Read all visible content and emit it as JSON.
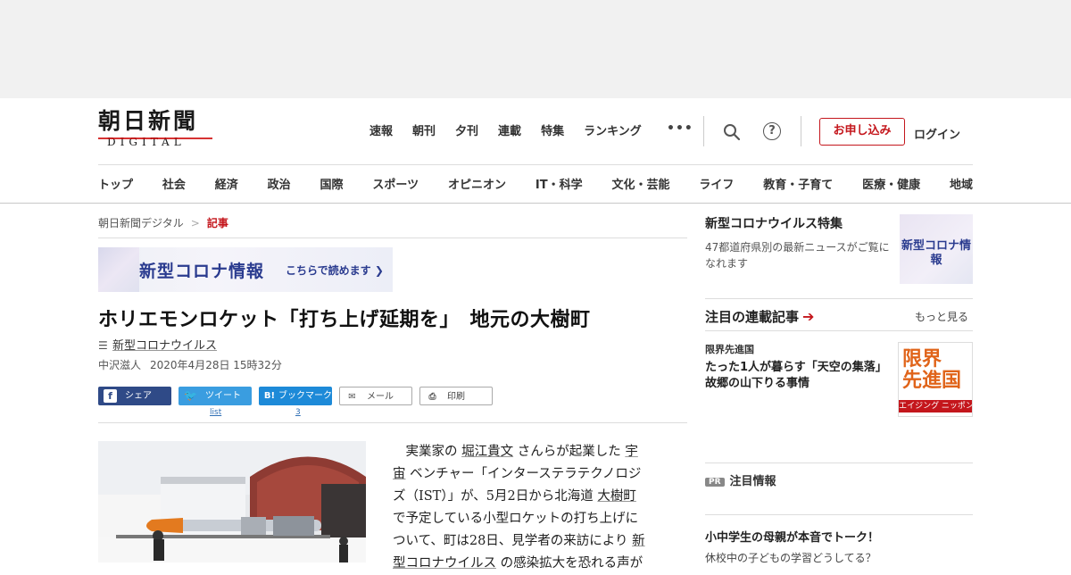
{
  "logo": {
    "main": "朝日新聞",
    "sub": "DIGITAL"
  },
  "topnav": [
    "速報",
    "朝刊",
    "夕刊",
    "連載",
    "特集",
    "ランキング"
  ],
  "more": "•••",
  "header_actions": {
    "apply": "お申し込み",
    "login": "ログイン",
    "help": "?"
  },
  "sections": [
    "トップ",
    "社会",
    "経済",
    "政治",
    "国際",
    "スポーツ",
    "オピニオン",
    "IT・科学",
    "文化・芸能",
    "ライフ",
    "教育・子育て",
    "医療・健康",
    "地域"
  ],
  "breadcrumb": {
    "home": "朝日新聞デジタル",
    "sep": ">",
    "current": "記事"
  },
  "banner": {
    "title": "新型コロナ情報",
    "cta": "こちらで読めます ❯"
  },
  "article": {
    "headline": "ホリエモンロケット「打ち上げ延期を」　地元の大樹町",
    "tag": "新型コロナウイルス",
    "author": "中沢滋人",
    "date": "2020年4月28日 15時32分",
    "body_lines": [
      [
        "　実業家の ",
        {
          "u": "堀江貴文"
        },
        " さんらが起業した ",
        {
          "u": "宇"
        }
      ],
      [
        {
          "u": "宙"
        },
        " ベンチャー「インターステラテクノロジ"
      ],
      [
        "ズ（IST）」が、5月2日から北海道 ",
        {
          "u": "大樹町"
        }
      ],
      [
        "で予定している小型ロケットの打ち上げに"
      ],
      [
        "ついて、町は28日、見学者の来訪により ",
        {
          "u": "新"
        }
      ],
      [
        {
          "u": "型コロナウイルス"
        },
        " の感染拡大を恐れる声が"
      ]
    ]
  },
  "share": {
    "facebook": "シェア",
    "twitter": "ツイート",
    "twitter_count": "list",
    "hatena": "ブックマーク",
    "hatena_count": "3",
    "mail": "メール",
    "print": "印刷"
  },
  "sidebar": {
    "covid_title": "新型コロナウイルス特集",
    "covid_desc": "47都道府県別の最新ニュースがご覧になれます",
    "covid_thumb": "新型コロナ情報",
    "serial_title": "注目の連載記事",
    "serial_arrow": "➔",
    "more": "もっと見る",
    "serial_series": "限界先進国",
    "serial_headline": "たった1人が暮らす「天空の集落」　故郷の山下りる事情",
    "genkai_1": "限界",
    "genkai_2": "先進国",
    "genkai_band": "エイジング ニッポン",
    "pr_badge": "PR",
    "pr_title": "注目情報",
    "promo_title": "小中学生の母親が本音でトーク！",
    "promo_sub": "休校中の子どもの学習どうしてる？"
  }
}
